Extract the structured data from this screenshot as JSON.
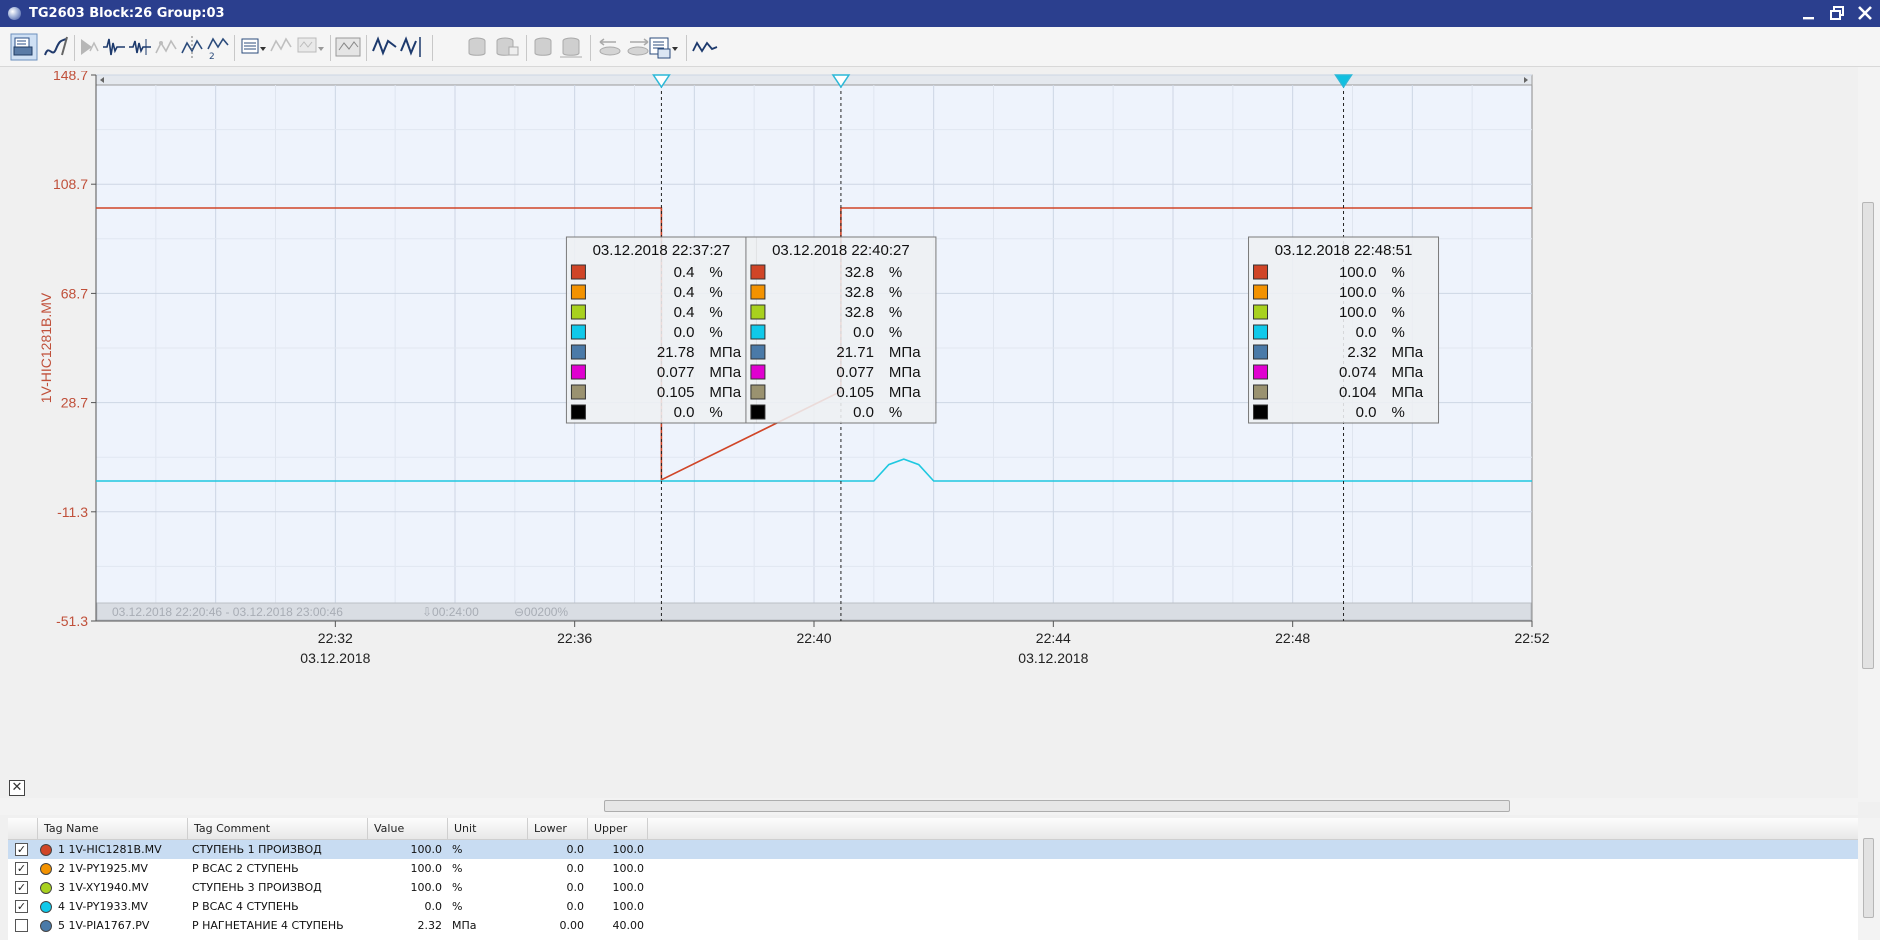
{
  "window": {
    "title": "TG2603 Block:26 Group:03",
    "controls": [
      "minimize-icon",
      "restore-icon",
      "close-icon"
    ]
  },
  "toolbar": {
    "icons": [
      "print-icon",
      "pen-icon",
      "play-trend-icon",
      "trend-step-icon",
      "trend-step2-icon",
      "trend-dots-icon",
      "trend-cursor-icon",
      "trend-2-icon",
      "layout-dropdown-icon",
      "trend-grey-icon",
      "trend-grey2-icon",
      "monitor-trend-icon",
      "trend-blue-icon",
      "trend-cursor-blue-icon",
      "db-icon",
      "db2-icon",
      "db3-icon",
      "db4-icon",
      "db5-icon",
      "db-arrows-icon",
      "db-arrows2-icon",
      "export-icon",
      "wave-icon"
    ]
  },
  "chart_data": {
    "type": "line",
    "ylabel": "1V-HIC1281B.MV",
    "y_ticks": [
      "148.7",
      "108.7",
      "68.7",
      "28.7",
      "-11.3",
      "-51.3"
    ],
    "ylim": [
      -51.3,
      148.7
    ],
    "x_ticks": [
      "22:32",
      "22:36",
      "22:40",
      "22:44",
      "22:48",
      "22:52"
    ],
    "x_dates": [
      "03.12.2018",
      "03.12.2018"
    ],
    "x_range": [
      "03.12.2018 22:20:46",
      "03.12.2018 23:00:46"
    ],
    "footer_range": "03.12.2018  22:20:46  -  03.12.2018  23:00:46",
    "footer_span": "⇩00:24:00",
    "footer_zoom": "⊖00200%",
    "grid": true,
    "series": [
      {
        "name": "1V-HIC1281B.MV",
        "color": "#d04527",
        "x": [
          "22:28:00",
          "22:37:27",
          "22:37:27",
          "22:40:27",
          "22:40:27",
          "22:52:00"
        ],
        "y": [
          100.0,
          100.0,
          0.4,
          32.8,
          100.0,
          100.0
        ]
      },
      {
        "name": "1V-PY1933.MV",
        "color": "#1ec8e0",
        "x": [
          "22:28:00",
          "22:41:00",
          "22:41:15",
          "22:41:30",
          "22:41:45",
          "22:42:00",
          "22:52:00"
        ],
        "y": [
          0.0,
          0.0,
          6.0,
          8.0,
          6.0,
          0.0,
          0.0
        ]
      }
    ],
    "cursors": [
      {
        "time": "03.12.2018 22:37:27",
        "marker": "hollow",
        "rows": [
          [
            "0.4",
            "%"
          ],
          [
            "0.4",
            "%"
          ],
          [
            "0.4",
            "%"
          ],
          [
            "0.0",
            "%"
          ],
          [
            "21.78",
            "МПа"
          ],
          [
            "0.077",
            "МПа"
          ],
          [
            "0.105",
            "МПа"
          ],
          [
            "0.0",
            "%"
          ]
        ]
      },
      {
        "time": "03.12.2018 22:40:27",
        "marker": "hollow",
        "rows": [
          [
            "32.8",
            "%"
          ],
          [
            "32.8",
            "%"
          ],
          [
            "32.8",
            "%"
          ],
          [
            "0.0",
            "%"
          ],
          [
            "21.71",
            "МПа"
          ],
          [
            "0.077",
            "МПа"
          ],
          [
            "0.105",
            "МПа"
          ],
          [
            "0.0",
            "%"
          ]
        ]
      },
      {
        "time": "03.12.2018 22:48:51",
        "marker": "filled",
        "rows": [
          [
            "100.0",
            "%"
          ],
          [
            "100.0",
            "%"
          ],
          [
            "100.0",
            "%"
          ],
          [
            "0.0",
            "%"
          ],
          [
            "2.32",
            "МПа"
          ],
          [
            "0.074",
            "МПа"
          ],
          [
            "0.104",
            "МПа"
          ],
          [
            "0.0",
            "%"
          ]
        ]
      }
    ],
    "swatch_colors": [
      "#d04527",
      "#f39200",
      "#a8d11e",
      "#10c9ea",
      "#4a7aa8",
      "#e000d0",
      "#9a9270",
      "#000000"
    ]
  },
  "table": {
    "columns": [
      "Tag Name",
      "Tag Comment",
      "Value",
      "Unit",
      "Lower",
      "Upper"
    ],
    "rows": [
      {
        "checked": true,
        "color": "#d04527",
        "num": "1",
        "tag": "1V-HIC1281B.MV",
        "comment": "СТУПЕНЬ 1   ПРОИЗВОД",
        "value": "100.0",
        "unit": "%",
        "lower": "0.0",
        "upper": "100.0"
      },
      {
        "checked": true,
        "color": "#f39200",
        "num": "2",
        "tag": "1V-PY1925.MV",
        "comment": "Р ВСАС 2 СТУПЕНЬ",
        "value": "100.0",
        "unit": "%",
        "lower": "0.0",
        "upper": "100.0"
      },
      {
        "checked": true,
        "color": "#a8d11e",
        "num": "3",
        "tag": "1V-XY1940.MV",
        "comment": "СТУПЕНЬ 3   ПРОИЗВОД",
        "value": "100.0",
        "unit": "%",
        "lower": "0.0",
        "upper": "100.0"
      },
      {
        "checked": true,
        "color": "#10c9ea",
        "num": "4",
        "tag": "1V-PY1933.MV",
        "comment": "Р ВСАС 4 СТУПЕНЬ",
        "value": "0.0",
        "unit": "%",
        "lower": "0.0",
        "upper": "100.0"
      },
      {
        "checked": false,
        "color": "#4a7aa8",
        "num": "5",
        "tag": "1V-PIA1767.PV",
        "comment": "Р НАГНЕТАНИЕ 4 СТУПЕНЬ",
        "value": "2.32",
        "unit": "МПа",
        "lower": "0.00",
        "upper": "40.00"
      }
    ]
  }
}
